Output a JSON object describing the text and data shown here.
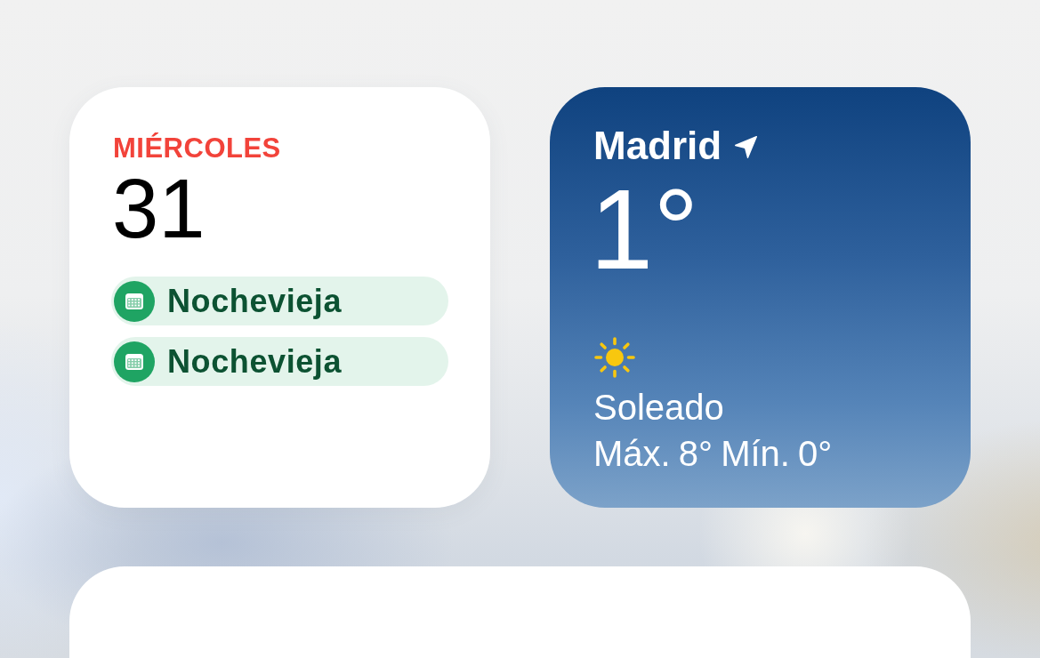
{
  "calendar_widget": {
    "weekday": "MIÉRCOLES",
    "day": "31",
    "events": [
      {
        "title": "Nochevieja",
        "color": "#1fa463"
      },
      {
        "title": "Nochevieja",
        "color": "#1fa463"
      }
    ]
  },
  "weather_widget": {
    "city": "Madrid",
    "location_on": true,
    "temperature": "1°",
    "condition": {
      "kind": "sun",
      "text": "Soleado"
    },
    "range": "Máx. 8° Mín. 0°"
  }
}
